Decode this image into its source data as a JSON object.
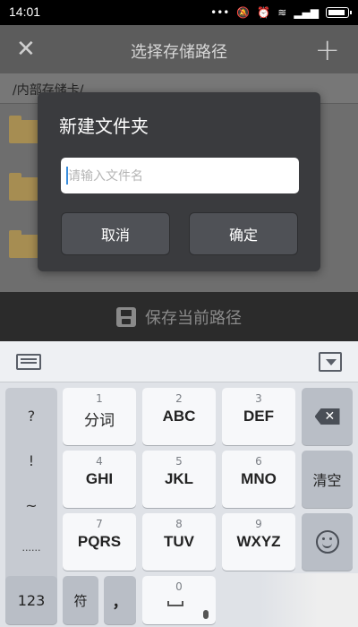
{
  "status_bar": {
    "time": "14:01",
    "icons": [
      "dots-icon",
      "mute-icon",
      "alarm-icon",
      "wifi-icon",
      "signal-icon",
      "battery-icon"
    ]
  },
  "app_bar": {
    "title": "选择存储路径",
    "close_icon": "close-icon",
    "add_icon": "plus-icon"
  },
  "content": {
    "path": "/内部存储卡/",
    "folders": 3
  },
  "save_bar": {
    "label": "保存当前路径"
  },
  "dialog": {
    "title": "新建文件夹",
    "input_placeholder": "请输入文件名",
    "cancel_label": "取消",
    "ok_label": "确定"
  },
  "keyboard": {
    "side_keys": [
      "?",
      "!",
      "~",
      "......"
    ],
    "rows": [
      [
        {
          "num": "1",
          "label": "分词"
        },
        {
          "num": "2",
          "label": "ABC"
        },
        {
          "num": "3",
          "label": "DEF"
        }
      ],
      [
        {
          "num": "4",
          "label": "GHI"
        },
        {
          "num": "5",
          "label": "JKL"
        },
        {
          "num": "6",
          "label": "MNO"
        }
      ],
      [
        {
          "num": "7",
          "label": "PQRS"
        },
        {
          "num": "8",
          "label": "TUV"
        },
        {
          "num": "9",
          "label": "WXYZ"
        }
      ]
    ],
    "clear_label": "清空",
    "bottom": {
      "num_label": "123",
      "symbol_label": "符",
      "comma_label": "，",
      "zero_num": "0"
    }
  }
}
